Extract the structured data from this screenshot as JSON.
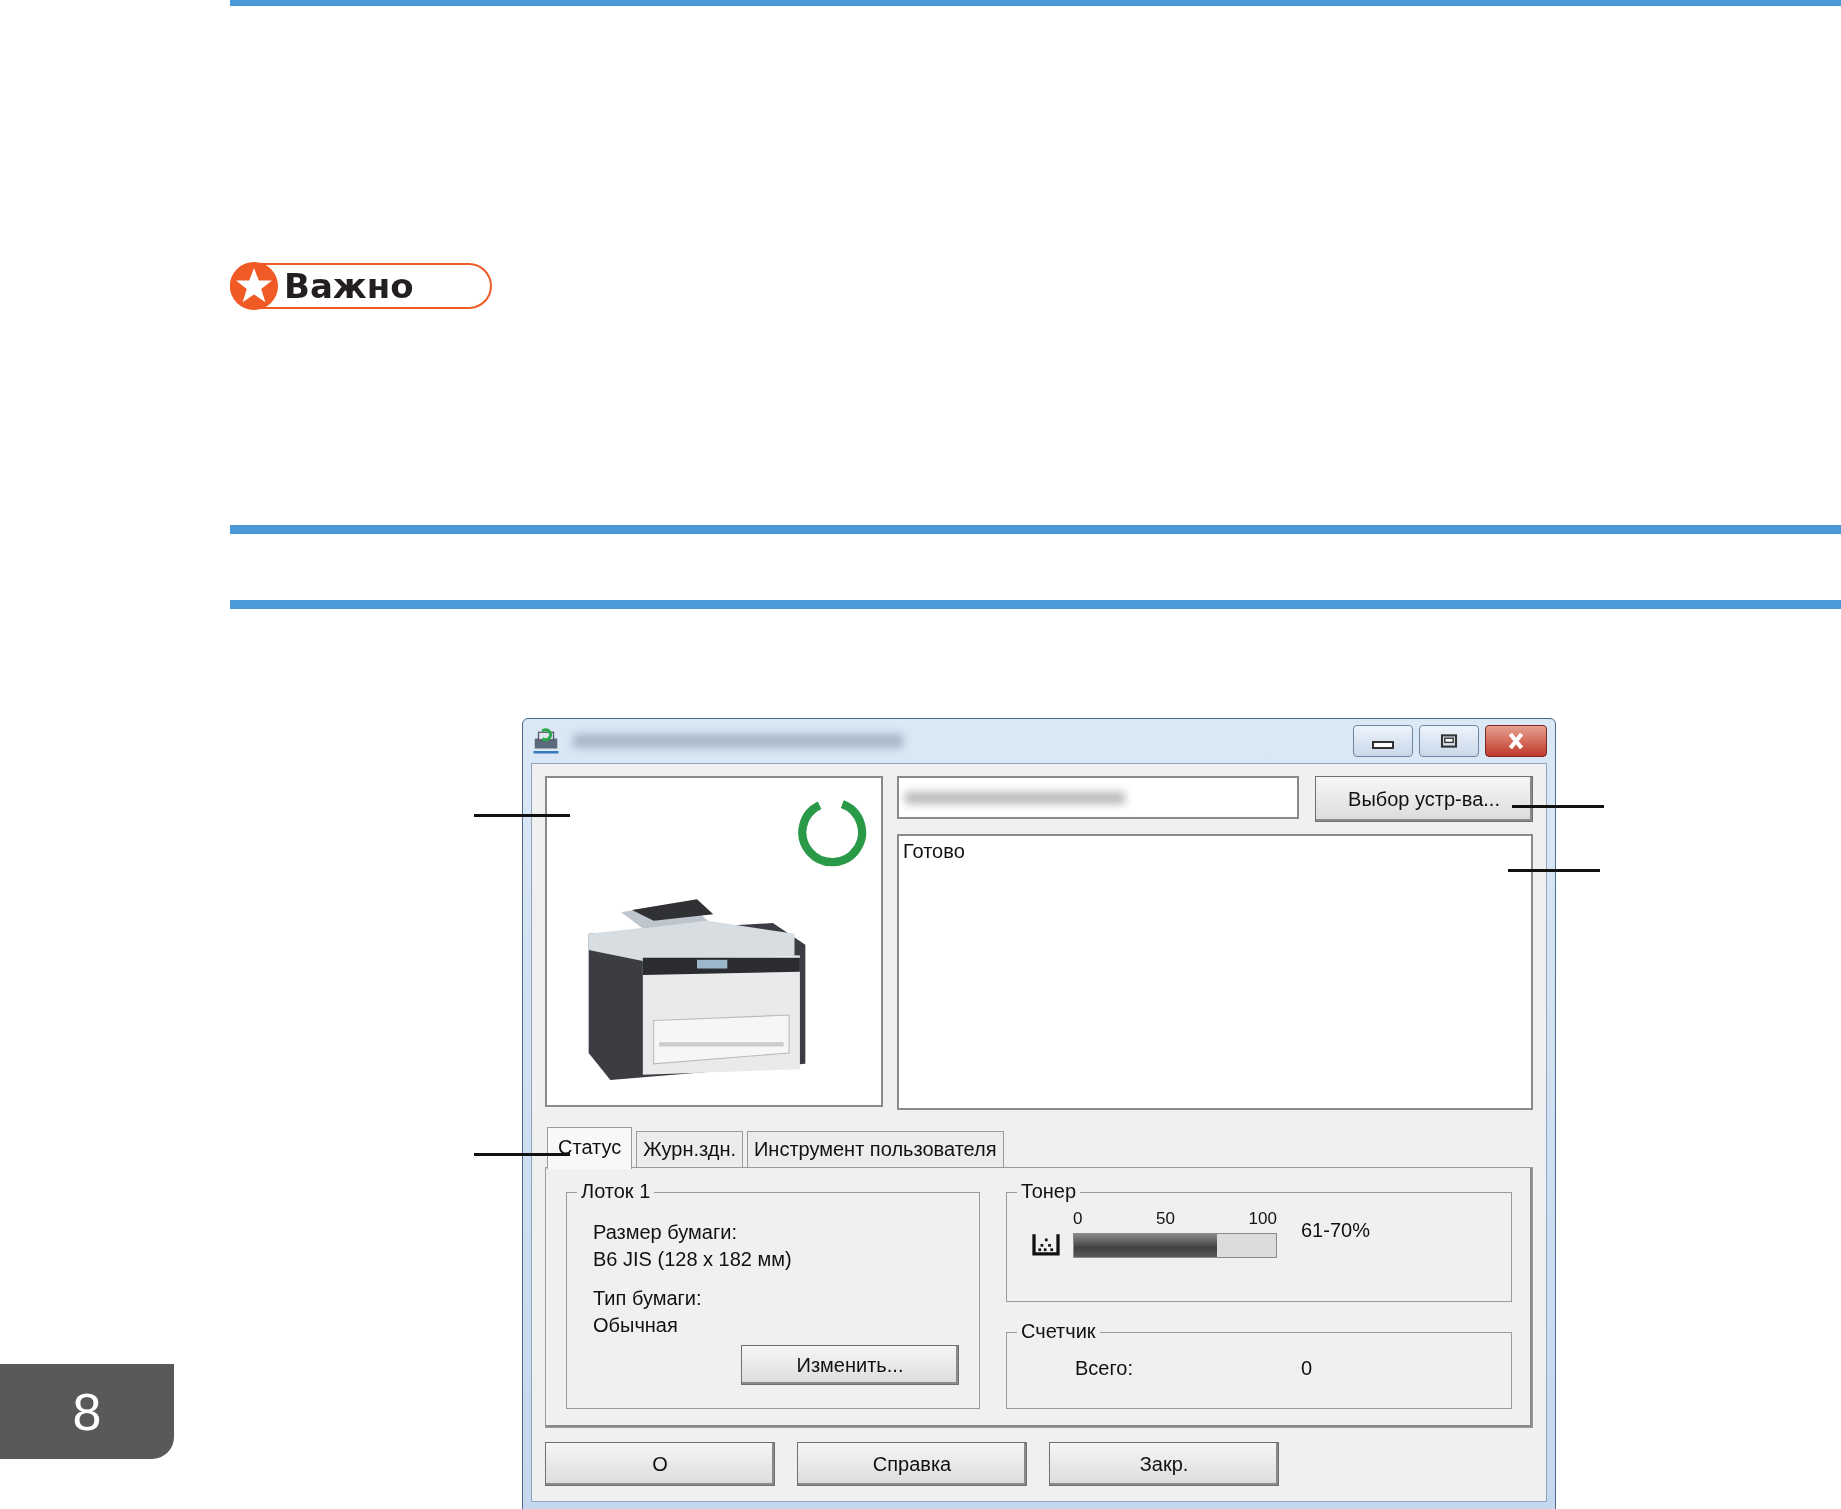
{
  "badge": {
    "label": "Важно"
  },
  "dialog": {
    "device_button": "Выбор устр-ва...",
    "status_text": "Готово",
    "tabs": [
      {
        "label": "Статус",
        "selected": true
      },
      {
        "label": "Журн.здн.",
        "selected": false
      },
      {
        "label": "Инструмент пользователя",
        "selected": false
      }
    ],
    "tray": {
      "title": "Лоток 1",
      "items": [
        {
          "label": "Размер бумаги:",
          "value": "B6 JIS (128 x 182 мм)"
        },
        {
          "label": "Тип бумаги:",
          "value": "Обычная"
        }
      ],
      "button": "Изменить..."
    },
    "toner": {
      "title": "Тонер",
      "ticks": [
        "0",
        "50",
        "100"
      ],
      "level": 0.71,
      "reading": "61-70%"
    },
    "counter": {
      "title": "Счетчик",
      "label": "Всего:",
      "value": "0"
    },
    "buttons": [
      "О",
      "Справка",
      "Закр."
    ]
  },
  "chapter": "8"
}
